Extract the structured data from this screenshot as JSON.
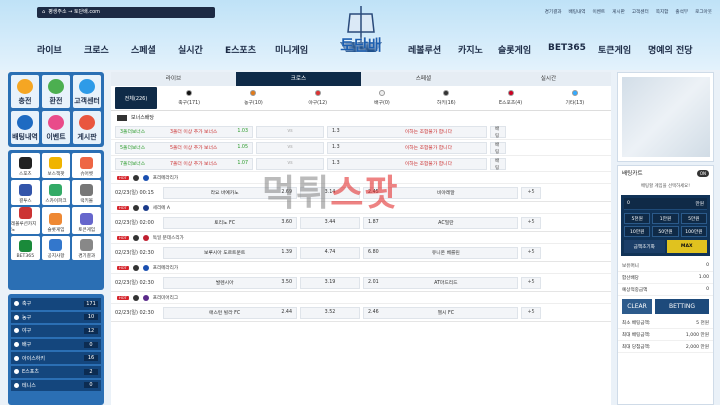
{
  "header": {
    "address_text": "평생주소 → 토단배.com",
    "logo_text": "토단배",
    "util_links": [
      "경기결과",
      "배팅내역",
      "이벤트",
      "게시판",
      "고객센터",
      "쪽지함",
      "출석부",
      "로그아웃"
    ],
    "nav_left": [
      "라이브",
      "크로스",
      "스페셜",
      "실시간",
      "E스포츠",
      "미니게임"
    ],
    "nav_right": [
      "레볼루션",
      "카지노",
      "슬롯게임",
      "BET365",
      "토큰게임",
      "명예의 전당"
    ]
  },
  "quick_menu": [
    {
      "label": "충전",
      "icon": "money-bag-icon",
      "color": "#f5a623"
    },
    {
      "label": "환전",
      "icon": "coins-icon",
      "color": "#4caf50"
    },
    {
      "label": "고객센터",
      "icon": "chat-bubble-icon",
      "color": "#2e9be8"
    },
    {
      "label": "배팅내역",
      "icon": "betting-slip-icon",
      "color": "#1e6bc2"
    },
    {
      "label": "이벤트",
      "icon": "gift-icon",
      "color": "#e94b8a"
    },
    {
      "label": "게시판",
      "icon": "megaphone-icon",
      "color": "#e9563f"
    }
  ],
  "game_menu": [
    "스포츠",
    "보스잭팟",
    "슈어벳",
    "결투스",
    "스카이파크",
    "럭키볼",
    "레볼루션카지노",
    "슬롯게임",
    "토큰게임",
    "BET365",
    "공지사항",
    "경기결과"
  ],
  "sport_list": [
    {
      "label": "축구",
      "count": "171"
    },
    {
      "label": "농구",
      "count": "10"
    },
    {
      "label": "야구",
      "count": "12"
    },
    {
      "label": "배구",
      "count": "0"
    },
    {
      "label": "아이스하키",
      "count": "16"
    },
    {
      "label": "E스포츠",
      "count": "2"
    },
    {
      "label": "테니스",
      "count": "0"
    }
  ],
  "main": {
    "tabs": [
      "라이브",
      "크로스",
      "스페셜",
      "실시간"
    ],
    "sport_filters": [
      "전체(226)",
      "축구(171)",
      "농구(10)",
      "야구(12)",
      "배구(0)",
      "하키(16)",
      "E스포츠(4)",
      "기타(13)"
    ],
    "bonus_section": "보너스배당",
    "bonus_rows": [
      {
        "name": "3폴더보너스",
        "desc": "3폴더 이상 추가 보너스",
        "odds": "1.03",
        "vs": "vs",
        "right_odds": "1.3",
        "right_desc": "이하는 조합불가 합니다",
        "btn": "배팅"
      },
      {
        "name": "5폴더보너스",
        "desc": "5폴더 이상 추가 보너스",
        "odds": "1.05",
        "vs": "vs",
        "right_odds": "1.3",
        "right_desc": "이하는 조합불가 합니다",
        "btn": "배팅"
      },
      {
        "name": "7폴더보너스",
        "desc": "7폴더 이상 추가 보너스",
        "odds": "1.07",
        "vs": "vs",
        "right_odds": "1.3",
        "right_desc": "이하는 조합불가 합니다",
        "btn": "배팅"
      }
    ],
    "matches": [
      {
        "league": "프리메라리가",
        "time": "02/23(일) 00:15",
        "home": "라요 바예카노",
        "h_odds": "2.69",
        "draw": "3.14",
        "a_odds": "2.45",
        "away": "비야레알",
        "more": "+5"
      },
      {
        "league": "세리에 A",
        "time": "02/23(일) 02:00",
        "home": "토리노 FC",
        "h_odds": "3.60",
        "draw": "3.44",
        "a_odds": "1.87",
        "away": "AC밀란",
        "more": "+5"
      },
      {
        "league": "독일 분데스리가",
        "time": "02/23(일) 02:30",
        "home": "보루시아 도르트문트",
        "h_odds": "1.39",
        "draw": "4.74",
        "a_odds": "6.80",
        "away": "유니온 베를린",
        "more": "+5"
      },
      {
        "league": "프리메라리가",
        "time": "02/23(일) 02:30",
        "home": "발렌시아",
        "h_odds": "3.50",
        "draw": "3.19",
        "a_odds": "2.01",
        "away": "AT마드리드",
        "more": "+5"
      },
      {
        "league": "프리미어리그",
        "time": "02/23(일) 02:30",
        "home": "애스턴 빌라 FC",
        "h_odds": "2.44",
        "draw": "3.52",
        "a_odds": "2.46",
        "away": "첼시 FC",
        "more": "+5"
      }
    ]
  },
  "betcart": {
    "title": "배팅카트",
    "toggle": "ON",
    "message": "배팅할 게임을 선택하세요!",
    "amount": "0",
    "amount_unit": "만원",
    "chips": [
      "5천원",
      "1만원",
      "5만원",
      "10만원",
      "50만원",
      "100만원"
    ],
    "reset": "금액초기화",
    "max": "MAX",
    "held_label": "보유머니",
    "held_value": "0",
    "total_odds_label": "합산배당",
    "total_odds": "1.00",
    "expect_label": "예상적중금액",
    "expect": "0",
    "clear": "CLEAR",
    "betting": "BETTING",
    "limits": [
      {
        "k": "최소 배팅금액:",
        "v": "5 천원"
      },
      {
        "k": "최대 배팅금액:",
        "v": "1,000 만원"
      },
      {
        "k": "최대 당첨금액:",
        "v": "2,000 만원"
      }
    ]
  },
  "watermark": {
    "a": "먹튀",
    "b": "스팟"
  }
}
